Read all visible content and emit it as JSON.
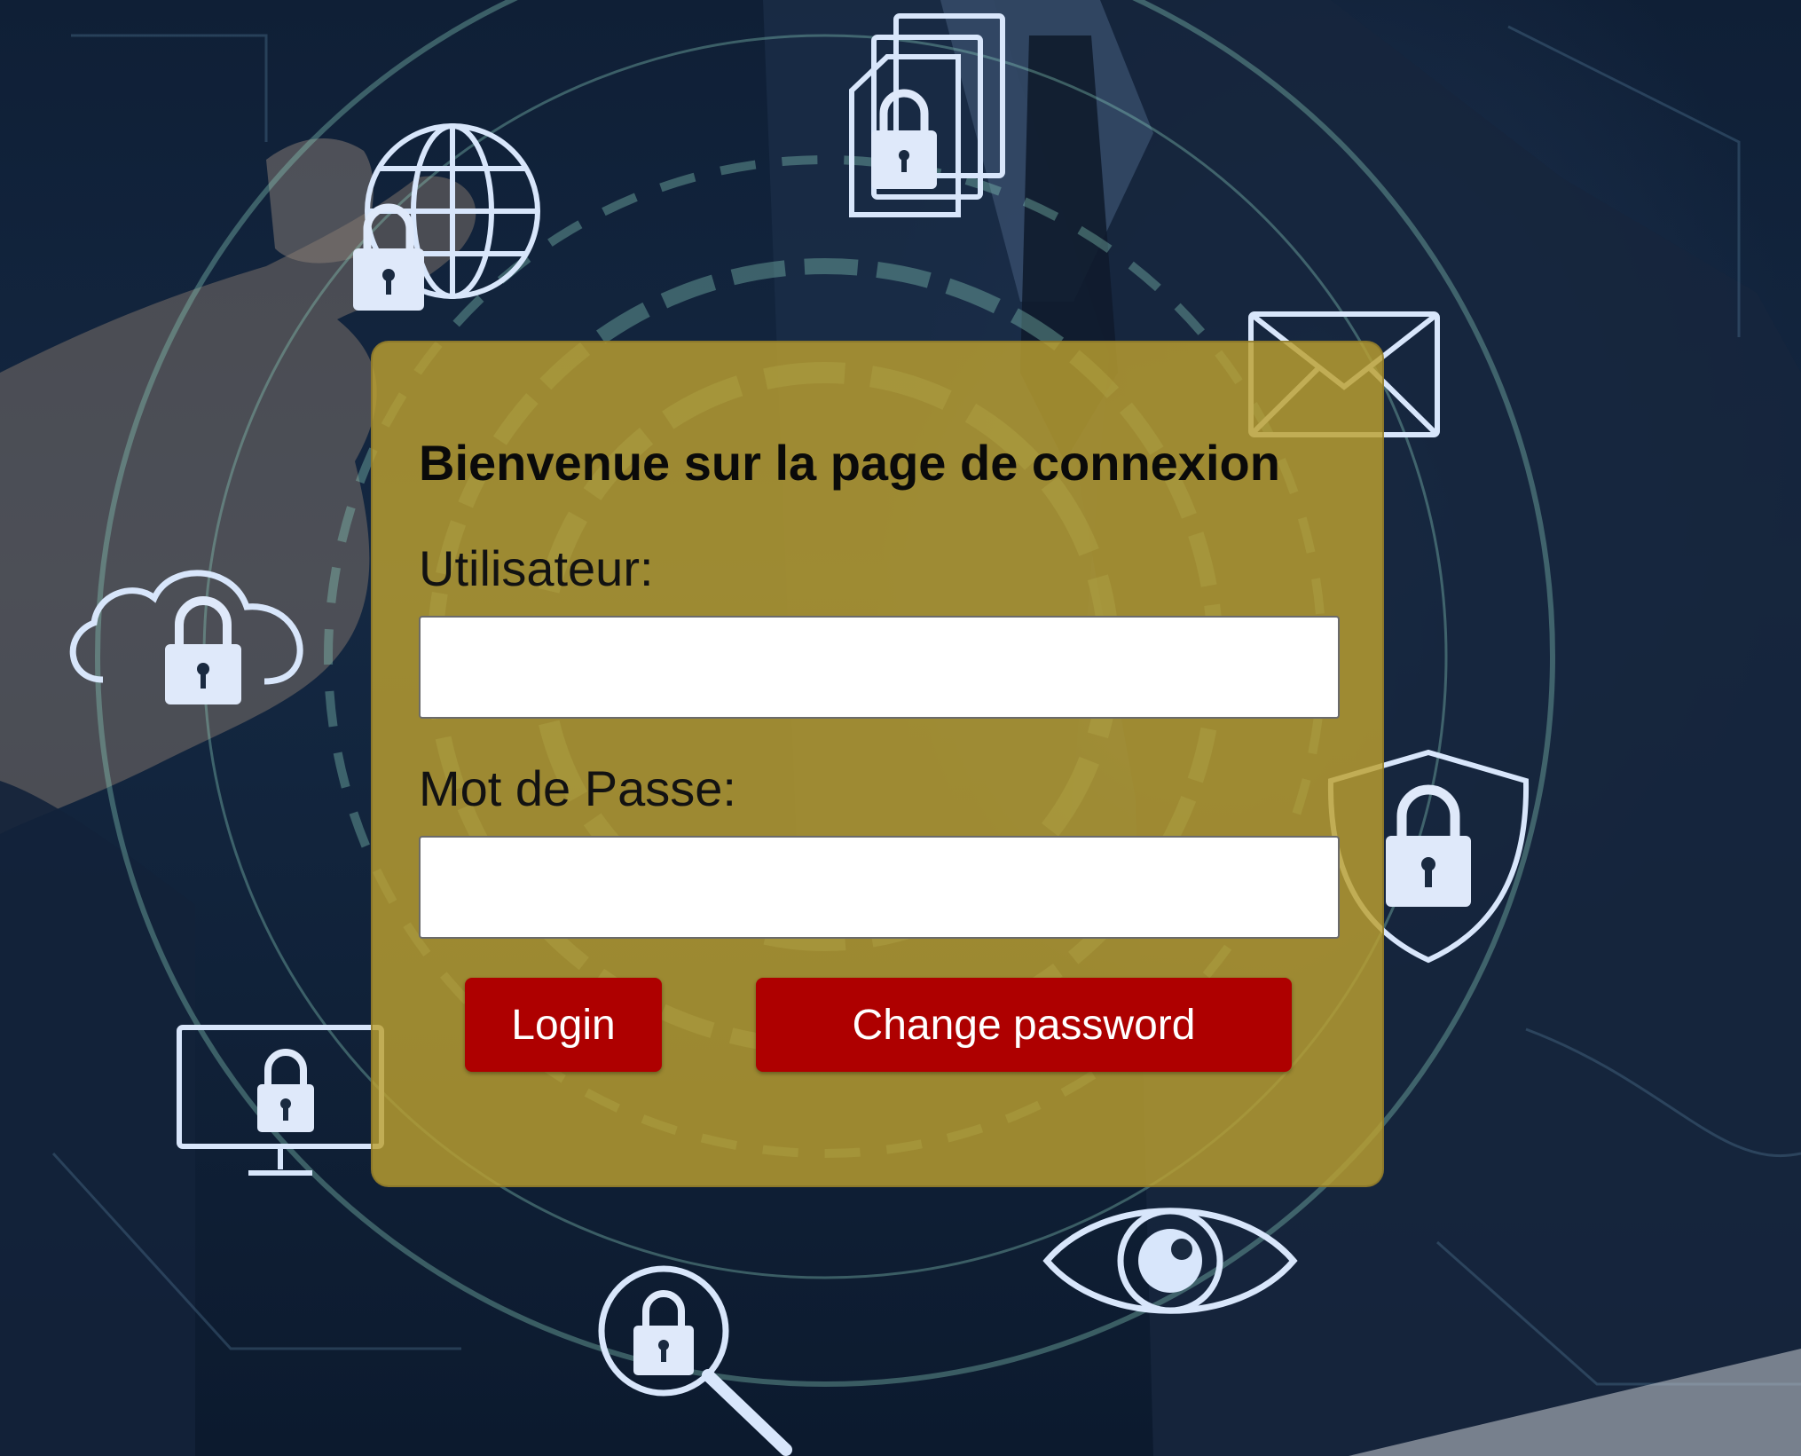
{
  "login": {
    "title": "Bienvenue sur la page de connexion",
    "username_label": "Utilisateur:",
    "username_value": "",
    "password_label": "Mot de Passe:",
    "password_value": "",
    "login_button": "Login",
    "change_password_button": "Change password"
  },
  "colors": {
    "card_background": "#bca030",
    "button_background": "#ae0000",
    "button_text": "#ffffff",
    "page_background": "#0f1f36",
    "icon_stroke": "#d8e6fb"
  },
  "background_icons": [
    "globe-lock-icon",
    "documents-lock-icon",
    "envelope-icon",
    "cloud-lock-icon",
    "shield-lock-icon",
    "monitor-lock-icon",
    "magnifier-lock-icon",
    "eye-icon"
  ]
}
